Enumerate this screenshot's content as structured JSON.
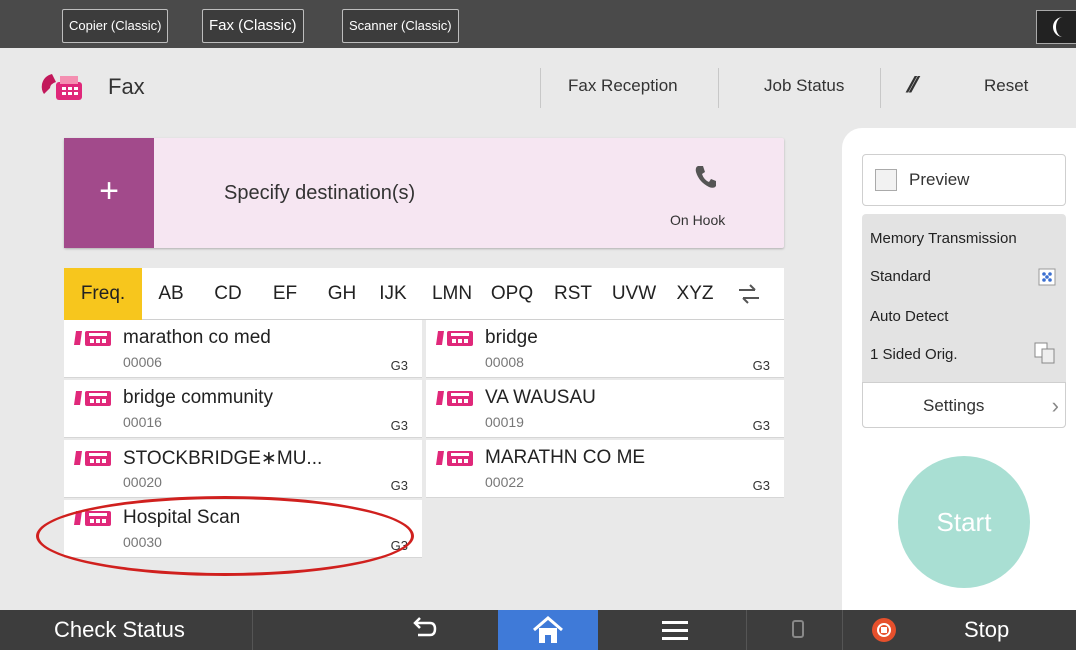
{
  "app_tabs": [
    "Copier (Classic)",
    "Fax (Classic)",
    "Scanner (Classic)"
  ],
  "header": {
    "title": "Fax",
    "fax_reception": "Fax Reception",
    "job_status": "Job Status",
    "reset": "Reset"
  },
  "destination": {
    "plus": "+",
    "label": "Specify destination(s)",
    "on_hook": "On Hook"
  },
  "index_tabs": [
    "Freq.",
    "AB",
    "CD",
    "EF",
    "GH",
    "IJK",
    "LMN",
    "OPQ",
    "RST",
    "UVW",
    "XYZ"
  ],
  "entries": [
    {
      "name": "marathon co med",
      "number": "00006",
      "type": "G3"
    },
    {
      "name": "bridge",
      "number": "00008",
      "type": "G3"
    },
    {
      "name": "bridge community",
      "number": "00016",
      "type": "G3"
    },
    {
      "name": "VA WAUSAU",
      "number": "00019",
      "type": "G3"
    },
    {
      "name": "STOCKBRIDGE∗MU...",
      "number": "00020",
      "type": "G3"
    },
    {
      "name": "MARATHN CO ME",
      "number": "00022",
      "type": "G3"
    },
    {
      "name": "Hospital Scan",
      "number": "00030",
      "type": "G3"
    }
  ],
  "panel": {
    "preview": "Preview",
    "memory_transmission": "Memory Transmission",
    "standard": "Standard",
    "auto_detect": "Auto Detect",
    "sided": "1 Sided Orig.",
    "settings": "Settings",
    "start": "Start"
  },
  "bottom": {
    "check_status": "Check Status",
    "stop": "Stop"
  },
  "colors": {
    "accent_magenta": "#a24a8b",
    "dest_bg": "#f6e6f2",
    "selected_tab": "#f7c61d",
    "start": "#a9dfd3",
    "home": "#3f7ad8",
    "highlight_circle": "#d0201e"
  }
}
